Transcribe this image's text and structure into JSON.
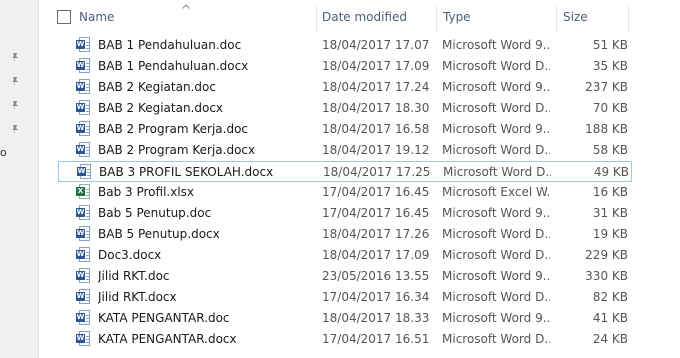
{
  "navigation": {
    "partial_label": "o"
  },
  "columns": {
    "name": "Name",
    "date_modified": "Date modified",
    "type": "Type",
    "size": "Size"
  },
  "colors": {
    "word": "#2b579a",
    "excel": "#217346",
    "selection_border": "#99c9ef"
  },
  "files": [
    {
      "name": "BAB 1 Pendahuluan.doc",
      "date": "18/04/2017 17.07",
      "type": "Microsoft Word 9...",
      "size": "51 KB",
      "icon": "word-doc-icon"
    },
    {
      "name": "BAB 1 Pendahuluan.docx",
      "date": "18/04/2017 17.09",
      "type": "Microsoft Word D...",
      "size": "35 KB",
      "icon": "word-doc-icon"
    },
    {
      "name": "BAB 2 Kegiatan.doc",
      "date": "18/04/2017 17.24",
      "type": "Microsoft Word 9...",
      "size": "237 KB",
      "icon": "word-doc-icon"
    },
    {
      "name": "BAB 2 Kegiatan.docx",
      "date": "18/04/2017 18.30",
      "type": "Microsoft Word D...",
      "size": "70 KB",
      "icon": "word-doc-icon"
    },
    {
      "name": "BAB 2 Program Kerja.doc",
      "date": "18/04/2017 16.58",
      "type": "Microsoft Word 9...",
      "size": "188 KB",
      "icon": "word-doc-icon"
    },
    {
      "name": "BAB 2 Program Kerja.docx",
      "date": "18/04/2017 19.12",
      "type": "Microsoft Word D...",
      "size": "58 KB",
      "icon": "word-doc-icon"
    },
    {
      "name": "BAB 3 PROFIL SEKOLAH.docx",
      "date": "18/04/2017 17.25",
      "type": "Microsoft Word D...",
      "size": "49 KB",
      "icon": "word-doc-icon",
      "selected": true
    },
    {
      "name": "Bab 3 Profil.xlsx",
      "date": "17/04/2017 16.45",
      "type": "Microsoft Excel W...",
      "size": "16 KB",
      "icon": "excel-doc-icon"
    },
    {
      "name": "Bab 5 Penutup.doc",
      "date": "17/04/2017 16.45",
      "type": "Microsoft Word 9...",
      "size": "31 KB",
      "icon": "word-doc-icon"
    },
    {
      "name": "BAB 5 Penutup.docx",
      "date": "18/04/2017 17.26",
      "type": "Microsoft Word D...",
      "size": "19 KB",
      "icon": "word-doc-icon"
    },
    {
      "name": "Doc3.docx",
      "date": "18/04/2017 17.09",
      "type": "Microsoft Word D...",
      "size": "229 KB",
      "icon": "word-doc-icon"
    },
    {
      "name": "Jilid RKT.doc",
      "date": "23/05/2016 13.55",
      "type": "Microsoft Word 9...",
      "size": "330 KB",
      "icon": "word-doc-icon"
    },
    {
      "name": "Jilid RKT.docx",
      "date": "17/04/2017 16.34",
      "type": "Microsoft Word D...",
      "size": "82 KB",
      "icon": "word-doc-icon"
    },
    {
      "name": "KATA PENGANTAR.doc",
      "date": "18/04/2017 18.33",
      "type": "Microsoft Word 9...",
      "size": "41 KB",
      "icon": "word-doc-icon"
    },
    {
      "name": "KATA PENGANTAR.docx",
      "date": "17/04/2017 16.51",
      "type": "Microsoft Word D...",
      "size": "24 KB",
      "icon": "word-doc-icon"
    }
  ]
}
